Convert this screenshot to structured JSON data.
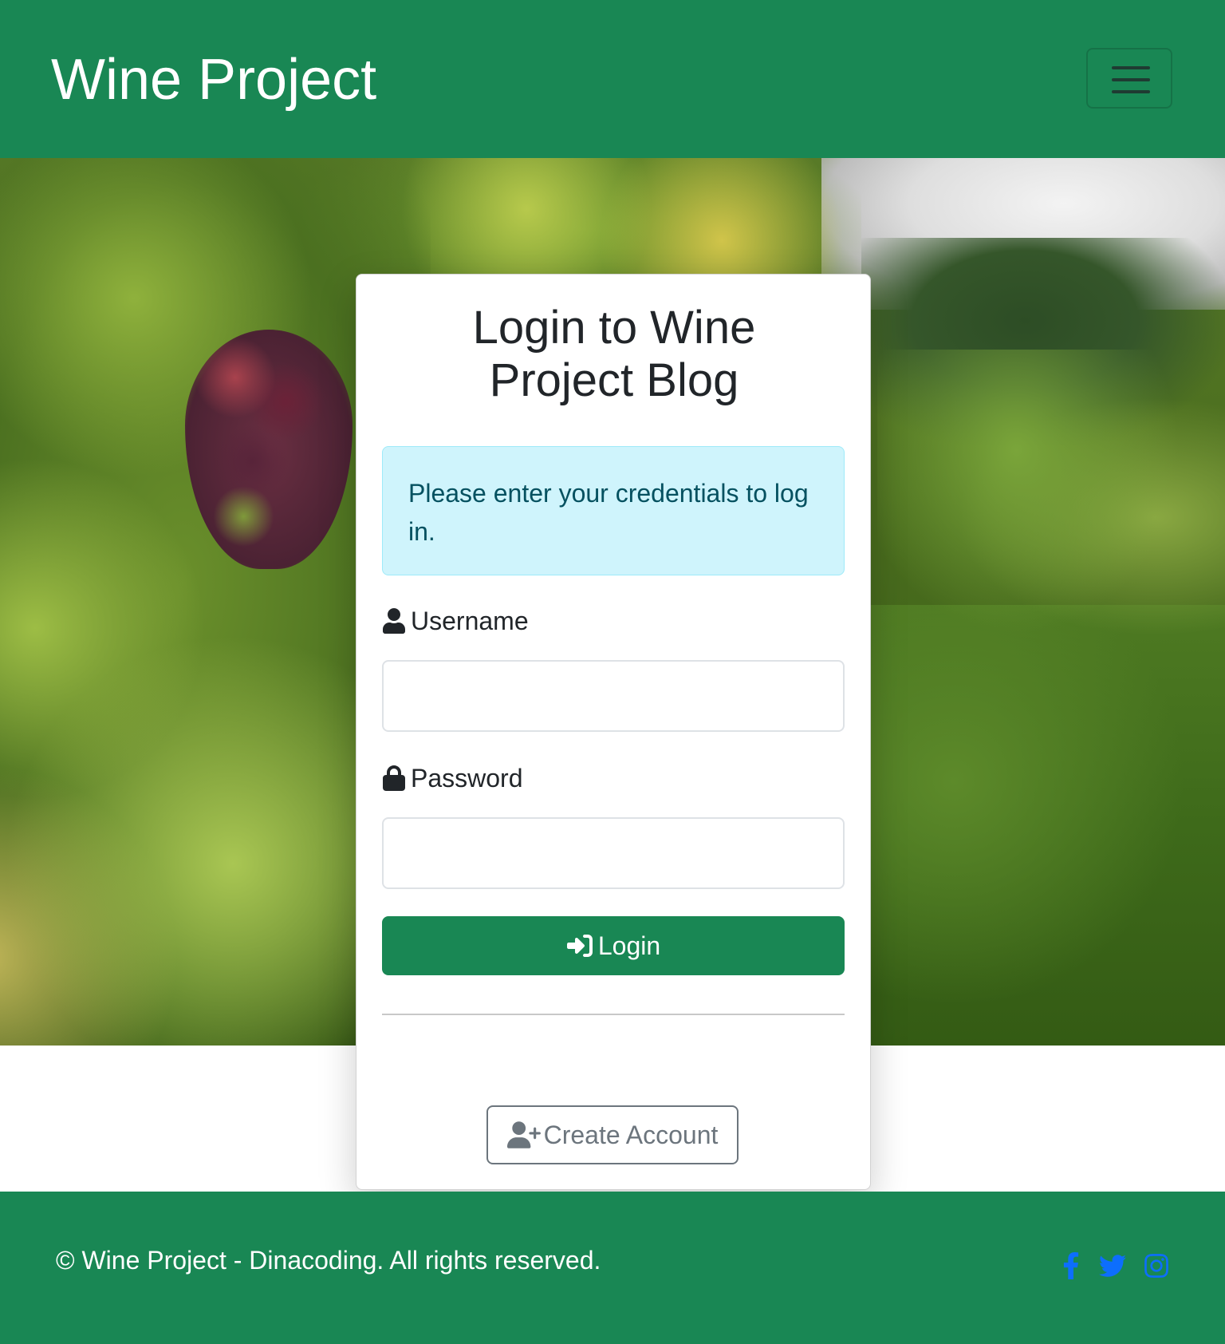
{
  "navbar": {
    "brand": "Wine Project",
    "toggler_icon": "hamburger-menu-icon"
  },
  "hero": {
    "image": "vineyard-background"
  },
  "login_card": {
    "title_line1": "Login to Wine",
    "title_line2": "Project Blog",
    "alert": "Please enter your credentials to log in.",
    "username_label": "Username",
    "username_icon": "user-icon",
    "username_value": "",
    "password_label": "Password",
    "password_icon": "lock-icon",
    "password_value": "",
    "login_button": "Login",
    "login_icon": "sign-in-icon",
    "create_button": "Create Account",
    "create_icon": "user-plus-icon"
  },
  "footer": {
    "copyright": "© Wine Project - Dinacoding. All rights reserved.",
    "social": [
      "facebook-icon",
      "twitter-icon",
      "instagram-icon"
    ]
  },
  "colors": {
    "primary_green": "#198754",
    "alert_bg": "#cff4fc",
    "alert_text": "#055160",
    "social_blue": "#0d6efd",
    "secondary_gray": "#6c757d"
  }
}
